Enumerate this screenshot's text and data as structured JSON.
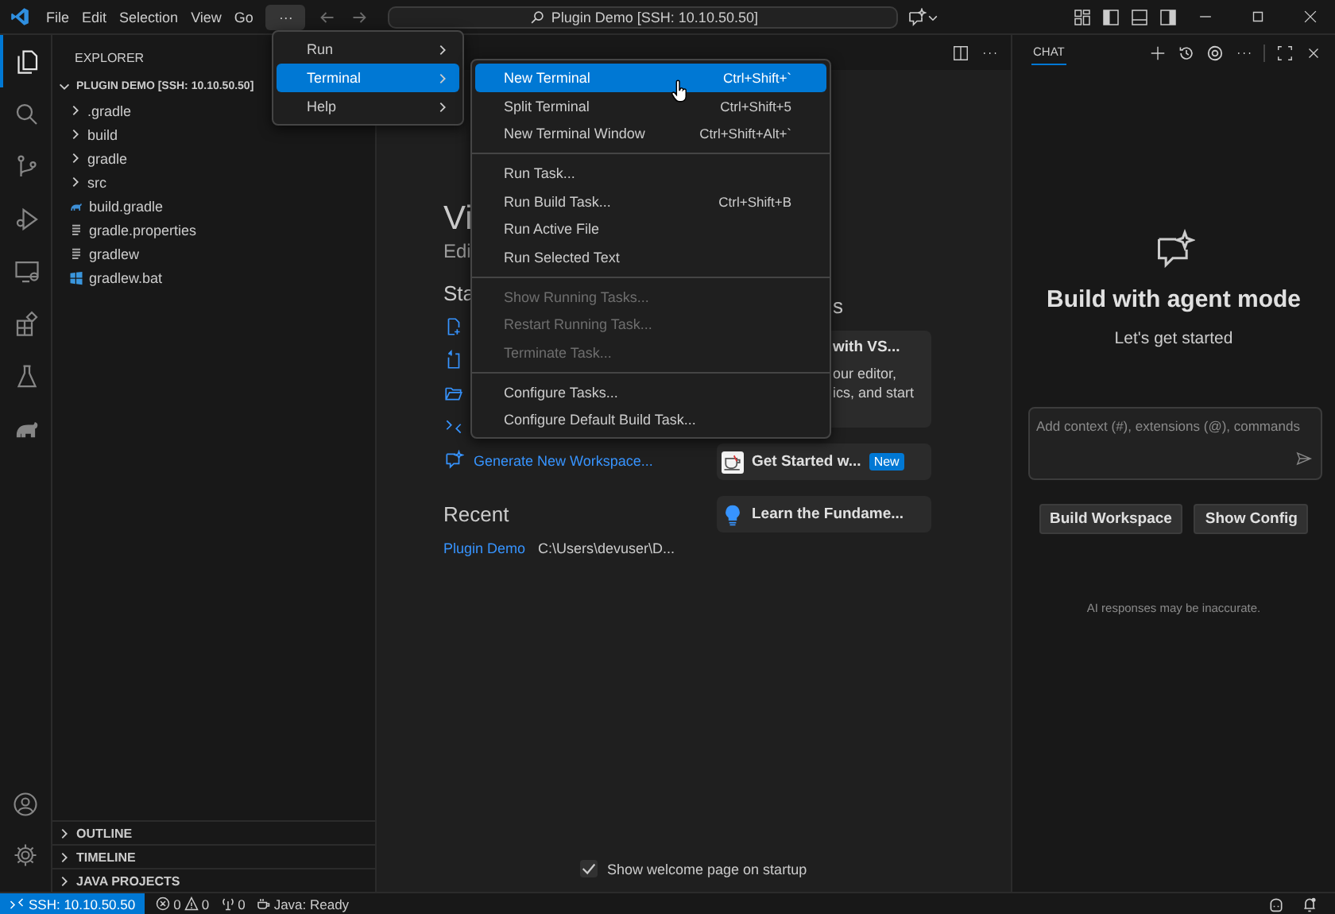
{
  "title_bar": {
    "menus": [
      {
        "label": "File",
        "selected": false
      },
      {
        "label": "Edit",
        "selected": false
      },
      {
        "label": "Selection",
        "selected": false
      },
      {
        "label": "View",
        "selected": false
      },
      {
        "label": "Go",
        "selected": false
      },
      {
        "label": "···",
        "selected": true
      }
    ],
    "command_center": "Plugin Demo [SSH: 10.10.50.50]"
  },
  "activity_bar": [
    {
      "kind": "explorer",
      "selected": true
    },
    {
      "kind": "search",
      "selected": false
    },
    {
      "kind": "source-control",
      "selected": false
    },
    {
      "kind": "run-debug",
      "selected": false
    },
    {
      "kind": "remote",
      "selected": false
    },
    {
      "kind": "extensions",
      "selected": false
    },
    {
      "kind": "testing",
      "selected": false
    },
    {
      "kind": "gradle",
      "selected": false
    }
  ],
  "sidebar": {
    "title": "EXPLORER",
    "root": {
      "label": "PLUGIN DEMO [SSH: 10.10.50.50]",
      "expanded": true,
      "children": [
        {
          "label": ".gradle",
          "kind": "folder",
          "expanded": false
        },
        {
          "label": "build",
          "kind": "folder",
          "expanded": false
        },
        {
          "label": "gradle",
          "kind": "folder",
          "expanded": false
        },
        {
          "label": "src",
          "kind": "folder",
          "expanded": false
        },
        {
          "label": "build.gradle",
          "kind": "gradle"
        },
        {
          "label": "gradle.properties",
          "kind": "text"
        },
        {
          "label": "gradlew",
          "kind": "text"
        },
        {
          "label": "gradlew.bat",
          "kind": "windows"
        }
      ]
    },
    "sections": [
      {
        "label": "OUTLINE",
        "expanded": false
      },
      {
        "label": "TIMELINE",
        "expanded": false
      },
      {
        "label": "JAVA PROJECTS",
        "expanded": false
      }
    ]
  },
  "welcome": {
    "title": "Vi",
    "subtitle": "Edi",
    "start_heading": "Sta",
    "start_items": [
      {
        "kind": "new-file"
      },
      {
        "kind": "open-file"
      },
      {
        "kind": "open-folder"
      },
      {
        "kind": "connect"
      },
      {
        "kind": "agent",
        "label": "Generate New Workspace..."
      }
    ],
    "recent_heading": "Recent",
    "recent": [
      {
        "name": "Plugin Demo",
        "path": "C:\\Users\\devuser\\D..."
      }
    ],
    "walkthroughs_heading": "s",
    "walkthroughs": [
      {
        "kind": "featured",
        "title": "with VS...",
        "lines": [
          "our editor,",
          "ics, and start"
        ]
      },
      {
        "kind": "coffee",
        "title": "Get Started w...",
        "badge": "New"
      },
      {
        "kind": "bulb",
        "title": "Learn the Fundame..."
      }
    ],
    "show_on_startup": {
      "label": "Show welcome page on startup",
      "checked": true
    }
  },
  "menu": {
    "items": [
      {
        "label": "Run",
        "selected": false
      },
      {
        "label": "Terminal",
        "selected": true
      },
      {
        "label": "Help",
        "selected": false
      }
    ]
  },
  "submenu": {
    "groups": [
      [
        {
          "label": "New Terminal",
          "shortcut": "Ctrl+Shift+`",
          "selected": true,
          "disabled": false
        },
        {
          "label": "Split Terminal",
          "shortcut": "Ctrl+Shift+5",
          "selected": false,
          "disabled": false
        },
        {
          "label": "New Terminal Window",
          "shortcut": "Ctrl+Shift+Alt+`",
          "selected": false,
          "disabled": false
        }
      ],
      [
        {
          "label": "Run Task...",
          "selected": false,
          "disabled": false
        },
        {
          "label": "Run Build Task...",
          "shortcut": "Ctrl+Shift+B",
          "selected": false,
          "disabled": false
        },
        {
          "label": "Run Active File",
          "selected": false,
          "disabled": false
        },
        {
          "label": "Run Selected Text",
          "selected": false,
          "disabled": false
        }
      ],
      [
        {
          "label": "Show Running Tasks...",
          "selected": false,
          "disabled": true
        },
        {
          "label": "Restart Running Task...",
          "selected": false,
          "disabled": true
        },
        {
          "label": "Terminate Task...",
          "selected": false,
          "disabled": true
        }
      ],
      [
        {
          "label": "Configure Tasks...",
          "selected": false,
          "disabled": false
        },
        {
          "label": "Configure Default Build Task...",
          "selected": false,
          "disabled": false
        }
      ]
    ]
  },
  "chat": {
    "tab": "CHAT",
    "heading": "Build with agent mode",
    "subheading": "Let's get started",
    "input_placeholder": "Add context (#), extensions (@), commands",
    "buttons": [
      "Build Workspace",
      "Show Config"
    ],
    "disclaimer": "AI responses may be inaccurate."
  },
  "status_bar": {
    "remote": "SSH: 10.10.50.50",
    "errors": "0",
    "warnings": "0",
    "ports": "0",
    "java": "Java: Ready"
  }
}
